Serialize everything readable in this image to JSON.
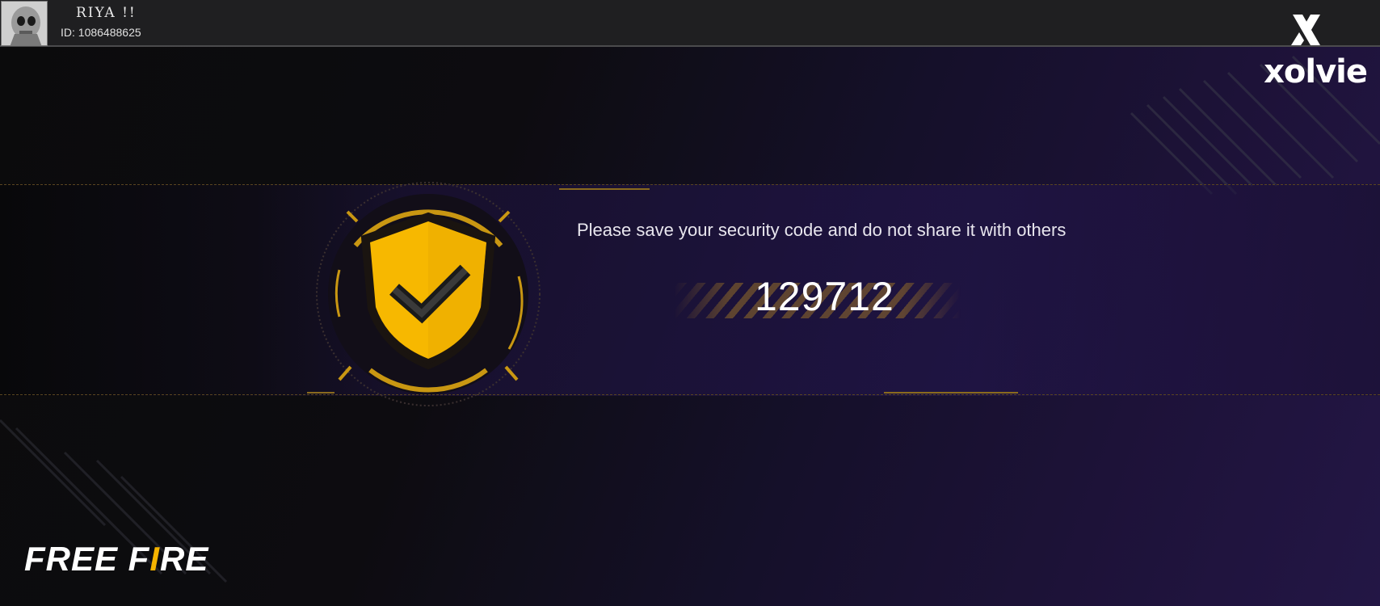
{
  "header": {
    "username": "RIYA !!",
    "user_id": "ID: 1086488625"
  },
  "brand": {
    "name": "xolvie",
    "icon": "xolvie-logo-icon"
  },
  "security": {
    "message": "Please save your security code and do not share it with others",
    "code": "129712",
    "icon": "shield-check-icon"
  },
  "game_logo": {
    "part1": "FREE F",
    "part2": "I",
    "part3": "RE"
  },
  "colors": {
    "accent_gold": "#f5b400",
    "band_purple": "#241650",
    "header_bg": "#1f1f21"
  }
}
